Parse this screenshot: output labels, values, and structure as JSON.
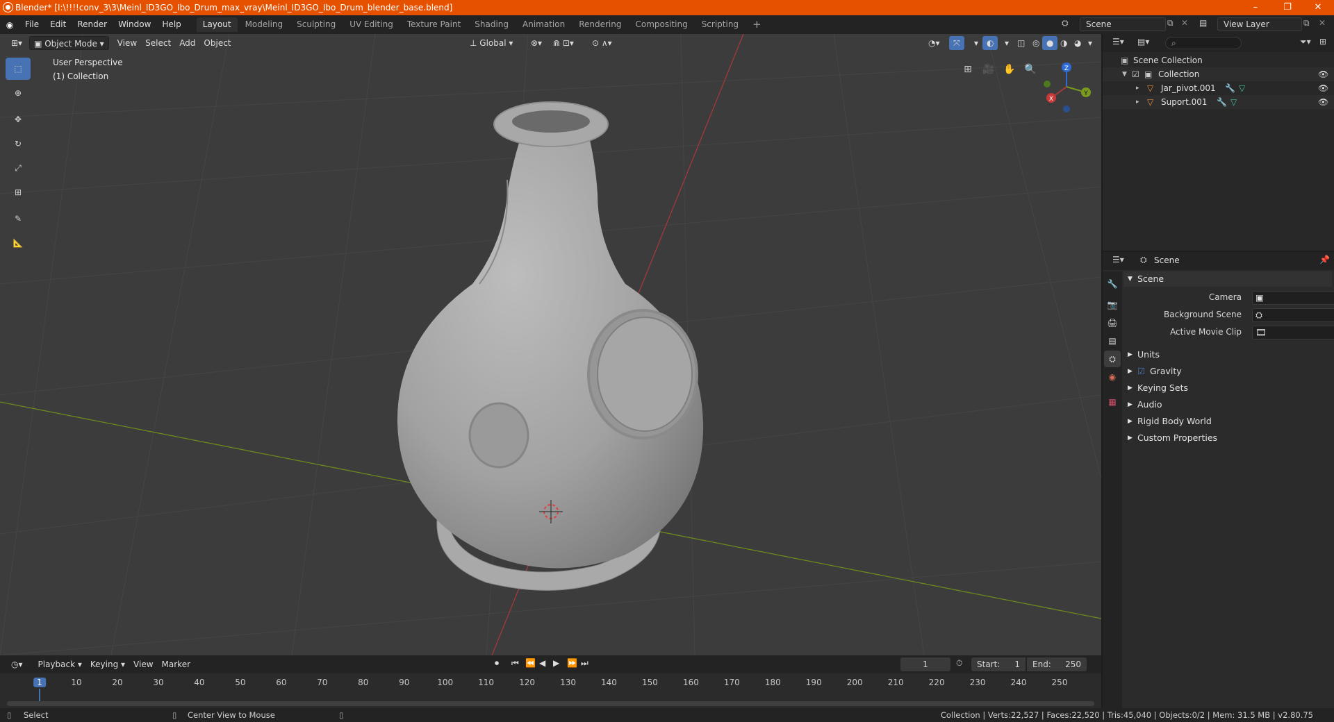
{
  "titlebar": {
    "title": "Blender* [I:\\!!!!conv_3\\3\\Meinl_ID3GO_Ibo_Drum_max_vray\\Meinl_ID3GO_Ibo_Drum_blender_base.blend]",
    "minimize": "–",
    "maximize": "❐",
    "close": "✕"
  },
  "menu": [
    "File",
    "Edit",
    "Render",
    "Window",
    "Help"
  ],
  "workspaces": [
    "Layout",
    "Modeling",
    "Sculpting",
    "UV Editing",
    "Texture Paint",
    "Shading",
    "Animation",
    "Rendering",
    "Compositing",
    "Scripting"
  ],
  "active_workspace": "Layout",
  "add_workspace": "+",
  "scene_name": "Scene",
  "view_layer": "View Layer",
  "viewport": {
    "mode": "Object Mode",
    "menus": [
      "View",
      "Select",
      "Add",
      "Object"
    ],
    "transform_orientation": "Global",
    "hud_line1": "User Perspective",
    "hud_line2": "(1) Collection",
    "gizmo": {
      "z": "Z",
      "y": "Y",
      "x": "X"
    }
  },
  "outliner": {
    "root": "Scene Collection",
    "collection": "Collection",
    "objects": [
      "Jar_pivot.001",
      "Suport.001"
    ]
  },
  "properties": {
    "header": "Scene",
    "panel": "Scene",
    "fields": [
      {
        "label": "Camera"
      },
      {
        "label": "Background Scene"
      },
      {
        "label": "Active Movie Clip"
      }
    ],
    "subpanels": [
      "Units",
      "Gravity",
      "Keying Sets",
      "Audio",
      "Rigid Body World",
      "Custom Properties"
    ]
  },
  "timeline": {
    "menus": [
      "Playback",
      "Keying",
      "View",
      "Marker"
    ],
    "current_frame": "1",
    "start_label": "Start:",
    "start": "1",
    "end_label": "End:",
    "end": "250",
    "ruler": [
      "1",
      "10",
      "20",
      "30",
      "40",
      "50",
      "60",
      "70",
      "80",
      "90",
      "100",
      "110",
      "120",
      "130",
      "140",
      "150",
      "160",
      "170",
      "180",
      "190",
      "200",
      "210",
      "220",
      "230",
      "240",
      "250"
    ]
  },
  "status": {
    "select": "Select",
    "center_view": "Center View to Mouse",
    "stats": "Collection | Verts:22,527 | Faces:22,520 | Tris:45,040 | Objects:0/2 | Mem: 31.5 MB | v2.80.75"
  },
  "colors": {
    "accent": "#4772b3",
    "title_bar": "#e65100",
    "axis_x": "#a33a3a",
    "axis_y": "#7a9a1f",
    "axis_z": "#2f6bd6"
  }
}
